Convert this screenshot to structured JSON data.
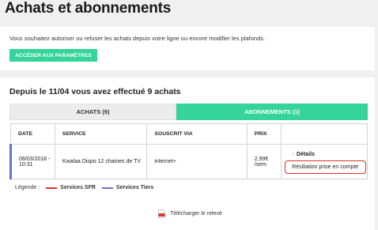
{
  "page": {
    "title": "Achats et abonnements"
  },
  "settings": {
    "description": "Vous souhaitez autoriser ou refuser les achats depuis votre ligne ou encore modifier les plafonds.",
    "button_label": "ACCÉDER AUX PARAMÈTRES"
  },
  "summary": {
    "text": "Depuis le 11/04 vous avez effectué 9 achats"
  },
  "tabs": [
    {
      "label": "ACHATS (9)",
      "active": false
    },
    {
      "label": "ABONNEMENTS (1)",
      "active": true
    }
  ],
  "table": {
    "headers": [
      "DATE",
      "SERVICE",
      "SOUSCRIT VIA",
      "PRIX",
      ""
    ],
    "rows": [
      {
        "date_line1": "08/03/2018 -",
        "date_line2": "10:31",
        "service": "Kwalaa Dispo 12 chaines de TV",
        "via": "internet+",
        "price_line1": "2,99€",
        "price_line2": "/sem",
        "details_label": "Détails",
        "status": "Résiliation prise en compte",
        "row_color": "#6a6fd6"
      }
    ]
  },
  "legend": {
    "label": "Légende :",
    "items": [
      {
        "label": "Services SFR",
        "color": "#e2312d"
      },
      {
        "label": "Services Tiers",
        "color": "#6a6fd6"
      }
    ]
  },
  "download": {
    "label": "Télécharger le relevé",
    "icon": "pdf-icon"
  },
  "colors": {
    "accent": "#35d49a",
    "highlight": "#d9302b"
  }
}
